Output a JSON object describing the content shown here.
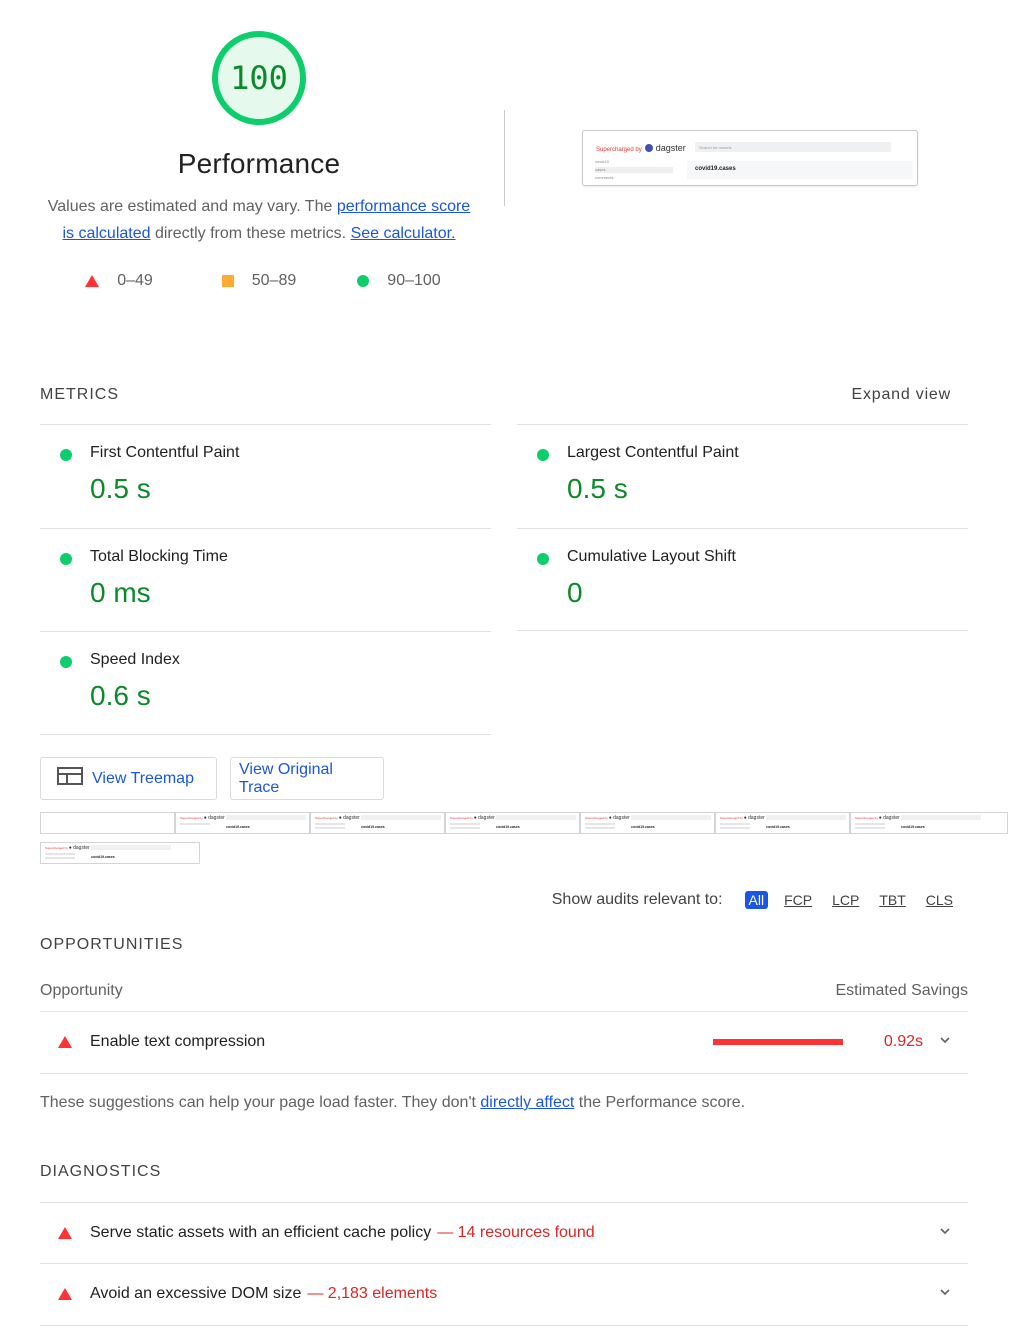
{
  "gauge": {
    "score": "100",
    "score_fraction": 1.0,
    "title": "Performance",
    "desc_prefix": "Values are estimated and may vary. The ",
    "desc_link1": "performance score is calculated",
    "desc_middle": " directly from these metrics. ",
    "desc_link2": "See calculator.",
    "color": "#0cce6b"
  },
  "legend": [
    {
      "range": "0–49",
      "icon": "triangle-red-icon"
    },
    {
      "range": "50–89",
      "icon": "square-orange-icon"
    },
    {
      "range": "90–100",
      "icon": "circle-green-icon"
    }
  ],
  "screenshot": {
    "brand_prefix": "Supercharged by",
    "brand_name": "dagster",
    "search_placeholder": "Search for models",
    "sidebar": [
      "covid19",
      "cases",
      "comments"
    ],
    "row_title": "covid19.cases",
    "row_subtitle": "source table"
  },
  "metrics": {
    "title": "Metrics",
    "expand_label": "Expand view",
    "items": [
      {
        "label": "First Contentful Paint",
        "value": "0.5 s"
      },
      {
        "label": "Largest Contentful Paint",
        "value": "0.5 s"
      },
      {
        "label": "Total Blocking Time",
        "value": "0 ms"
      },
      {
        "label": "Cumulative Layout Shift",
        "value": "0"
      },
      {
        "label": "Speed Index",
        "value": "0.6 s"
      }
    ]
  },
  "buttons": {
    "treemap": "View Treemap",
    "trace": "View Original Trace"
  },
  "filmstrip": {
    "frame_title": "covid19.cases"
  },
  "filter": {
    "label": "Show audits relevant to:",
    "chips": [
      "All",
      "FCP",
      "LCP",
      "TBT",
      "CLS"
    ],
    "active": "All"
  },
  "opportunities": {
    "title": "Opportunities",
    "col_left": "Opportunity",
    "col_right": "Estimated Savings",
    "items": [
      {
        "label": "Enable text compression",
        "savings": "0.92s"
      }
    ],
    "note_prefix": "These suggestions can help your page load faster. They don't ",
    "note_link": "directly affect",
    "note_suffix": " the Performance score."
  },
  "diagnostics": {
    "title": "Diagnostics",
    "items": [
      {
        "label": "Serve static assets with an efficient cache policy",
        "detail": "— 14 resources found"
      },
      {
        "label": "Avoid an excessive DOM size",
        "detail": "— 2,183 elements"
      }
    ]
  }
}
